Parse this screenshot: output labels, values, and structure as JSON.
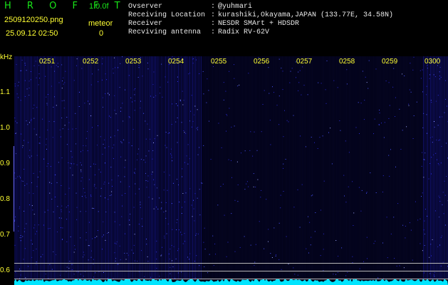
{
  "header": {
    "app_title": "H R O F F T",
    "version": "1.0.0f",
    "filename": "2509120250.png",
    "datetime": "25.09.12 02:50",
    "meteor_label": "meteor",
    "meteor_count": "0",
    "observer_label": "Ovserver",
    "observer_value": "@yuhmari",
    "location_label": "Receiving Location",
    "location_value": "kurashiki,Okayama,JAPAN (133.77E, 34.58N)",
    "receiver_label": "Receiver",
    "receiver_value": "NESDR SMArt + HDSDR",
    "antenna_label": "Recviving antenna",
    "antenna_value": "Radix RV-62V",
    "separator": ":"
  },
  "spectrogram": {
    "y_unit": "kHz",
    "y_ticks": [
      "1.1",
      "1.0",
      "0.9",
      "0.8",
      "0.7",
      "0.6"
    ],
    "x_ticks": [
      "0251",
      "0252",
      "0253",
      "0254",
      "0255",
      "0256",
      "0257",
      "0258",
      "0259",
      "0300"
    ]
  },
  "colors": {
    "background": "#000000",
    "title_green": "#19e619",
    "label_yellow": "#ffff33",
    "signal_blue": "#2a2aff",
    "baseline_cyan": "#00e5ff"
  }
}
